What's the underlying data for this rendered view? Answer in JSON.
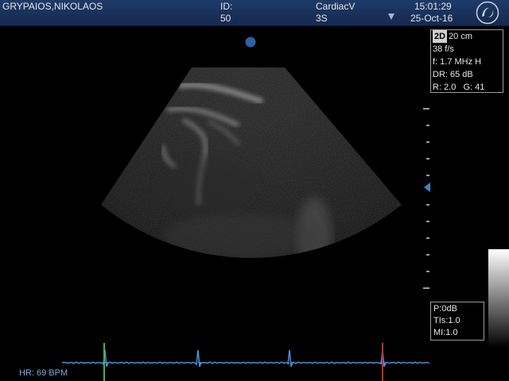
{
  "header": {
    "patient_name": "GRYPAIOS,NIKOLAOS",
    "id_label": "ID:",
    "id_value": "50",
    "preset": "CardiacV",
    "probe": "3S",
    "time": "15:01:29",
    "date": "25-Oct-16",
    "logo_icon": "ge-logo-icon"
  },
  "params": {
    "mode": "2D",
    "depth": "20 cm",
    "frame_rate": "38 f/s",
    "frequency": "f: 1.7 MHz H",
    "dynamic_range": "DR: 65 dB",
    "r_g": "R: 2.0   G: 41"
  },
  "acoustic": {
    "power": "P:0dB",
    "tis": "TIs:1.0",
    "mi": "MI:1.0"
  },
  "ecg": {
    "heart_rate": "HR: 69 BPM",
    "line_color": "#4a90d9"
  },
  "colors": {
    "header_bg": "#1f3a68",
    "marker": "#2f5fa8",
    "focus_marker": "#3a86c8"
  }
}
